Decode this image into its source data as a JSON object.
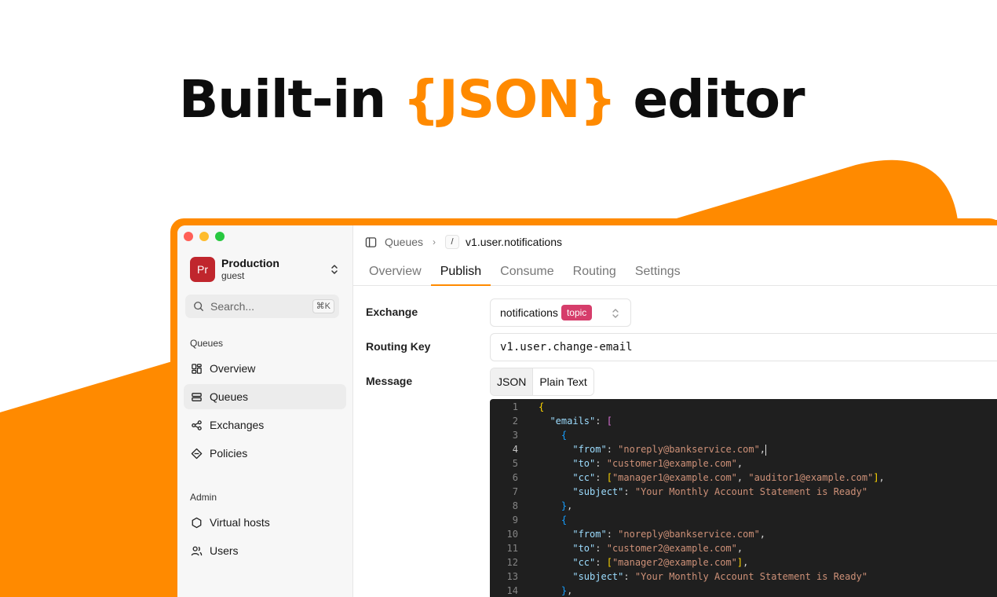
{
  "headline": {
    "before": "Built-in ",
    "accent": "{JSON}",
    "after": " editor"
  },
  "sidebar": {
    "account": {
      "initials": "Pr",
      "name": "Production",
      "role": "guest"
    },
    "search": {
      "placeholder": "Search...",
      "shortcut": "⌘K"
    },
    "sections": [
      {
        "label": "Queues",
        "items": [
          {
            "label": "Overview",
            "icon": "dashboard-icon"
          },
          {
            "label": "Queues",
            "icon": "queues-icon",
            "active": true
          },
          {
            "label": "Exchanges",
            "icon": "exchanges-icon"
          },
          {
            "label": "Policies",
            "icon": "policies-icon"
          }
        ]
      },
      {
        "label": "Admin",
        "items": [
          {
            "label": "Virtual hosts",
            "icon": "vhost-icon"
          },
          {
            "label": "Users",
            "icon": "users-icon"
          }
        ]
      }
    ]
  },
  "breadcrumb": {
    "parent": "Queues",
    "slash": "/",
    "current": "v1.user.notifications"
  },
  "tabs": [
    "Overview",
    "Publish",
    "Consume",
    "Routing",
    "Settings"
  ],
  "active_tab": "Publish",
  "form": {
    "exchange_label": "Exchange",
    "exchange_value": "notifications",
    "exchange_type": "topic",
    "routing_key_label": "Routing Key",
    "routing_key_value": "v1.user.change-email",
    "message_label": "Message",
    "format_options": [
      "JSON",
      "Plain Text"
    ],
    "format_selected": "JSON"
  },
  "editor": {
    "current_line": 4,
    "lines": [
      {
        "n": "1",
        "html": "<span class=\"b1\">{</span>"
      },
      {
        "n": "2",
        "html": "  <span class=\"k\">\"emails\"</span><span class=\"p\">: </span><span class=\"b2\">[</span>"
      },
      {
        "n": "3",
        "html": "    <span class=\"b3\">{</span>"
      },
      {
        "n": "4",
        "html": "      <span class=\"k\">\"from\"</span><span class=\"p\">: </span><span class=\"s\">\"noreply@bankservice.com\"</span><span class=\"p\">,</span><span class=\"cursor\"></span>"
      },
      {
        "n": "5",
        "html": "      <span class=\"k\">\"to\"</span><span class=\"p\">: </span><span class=\"s\">\"customer1@example.com\"</span><span class=\"p\">,</span>"
      },
      {
        "n": "6",
        "html": "      <span class=\"k\">\"cc\"</span><span class=\"p\">: </span><span class=\"b1\">[</span><span class=\"s\">\"manager1@example.com\"</span><span class=\"p\">, </span><span class=\"s\">\"auditor1@example.com\"</span><span class=\"b1\">]</span><span class=\"p\">,</span>"
      },
      {
        "n": "7",
        "html": "      <span class=\"k\">\"subject\"</span><span class=\"p\">: </span><span class=\"s\">\"Your Monthly Account Statement is Ready\"</span>"
      },
      {
        "n": "8",
        "html": "    <span class=\"b3\">}</span><span class=\"p\">,</span>"
      },
      {
        "n": "9",
        "html": "    <span class=\"b3\">{</span>"
      },
      {
        "n": "10",
        "html": "      <span class=\"k\">\"from\"</span><span class=\"p\">: </span><span class=\"s\">\"noreply@bankservice.com\"</span><span class=\"p\">,</span>"
      },
      {
        "n": "11",
        "html": "      <span class=\"k\">\"to\"</span><span class=\"p\">: </span><span class=\"s\">\"customer2@example.com\"</span><span class=\"p\">,</span>"
      },
      {
        "n": "12",
        "html": "      <span class=\"k\">\"cc\"</span><span class=\"p\">: </span><span class=\"b1\">[</span><span class=\"s\">\"manager2@example.com\"</span><span class=\"b1\">]</span><span class=\"p\">,</span>"
      },
      {
        "n": "13",
        "html": "      <span class=\"k\">\"subject\"</span><span class=\"p\">: </span><span class=\"s\">\"Your Monthly Account Statement is Ready\"</span>"
      },
      {
        "n": "14",
        "html": "    <span class=\"b3\">}</span><span class=\"p\">,</span>"
      }
    ]
  },
  "colors": {
    "accent": "#ff8a00",
    "avatar": "#c0262d",
    "badge": "#d63d6b",
    "editor_bg": "#1f1f1f"
  }
}
